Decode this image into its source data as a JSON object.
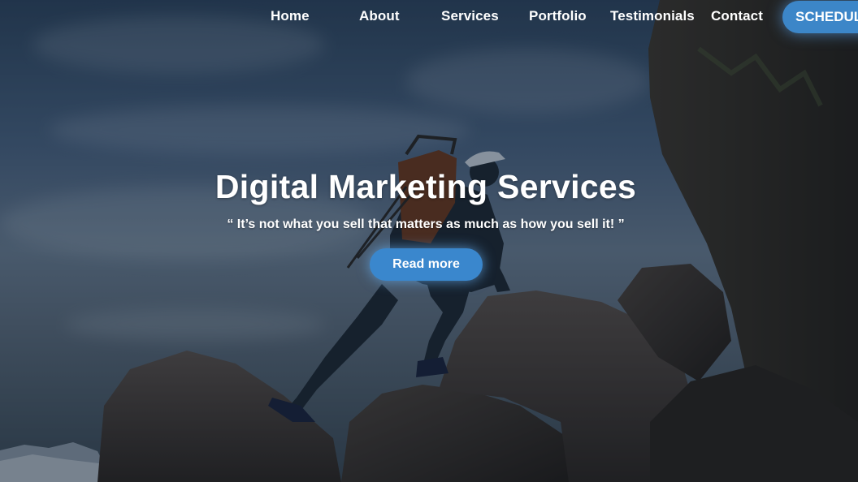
{
  "nav": {
    "items": [
      {
        "label": "Home"
      },
      {
        "label": "About"
      },
      {
        "label": "Services"
      },
      {
        "label": "Portfolio"
      },
      {
        "label": "Testimonials"
      },
      {
        "label": "Contact"
      }
    ],
    "cta_label": "SCHEDULE"
  },
  "hero": {
    "title": "Digital Marketing Services",
    "quote": "“ It’s not what you sell that matters as much as how you sell it! ”",
    "button_label": "Read more",
    "background_image": "hiker-climbing-rocks-photo"
  },
  "colors": {
    "accent": "#3a87cd",
    "text": "#ffffff",
    "sky": "#4a6585",
    "rock": "#3a3632"
  }
}
